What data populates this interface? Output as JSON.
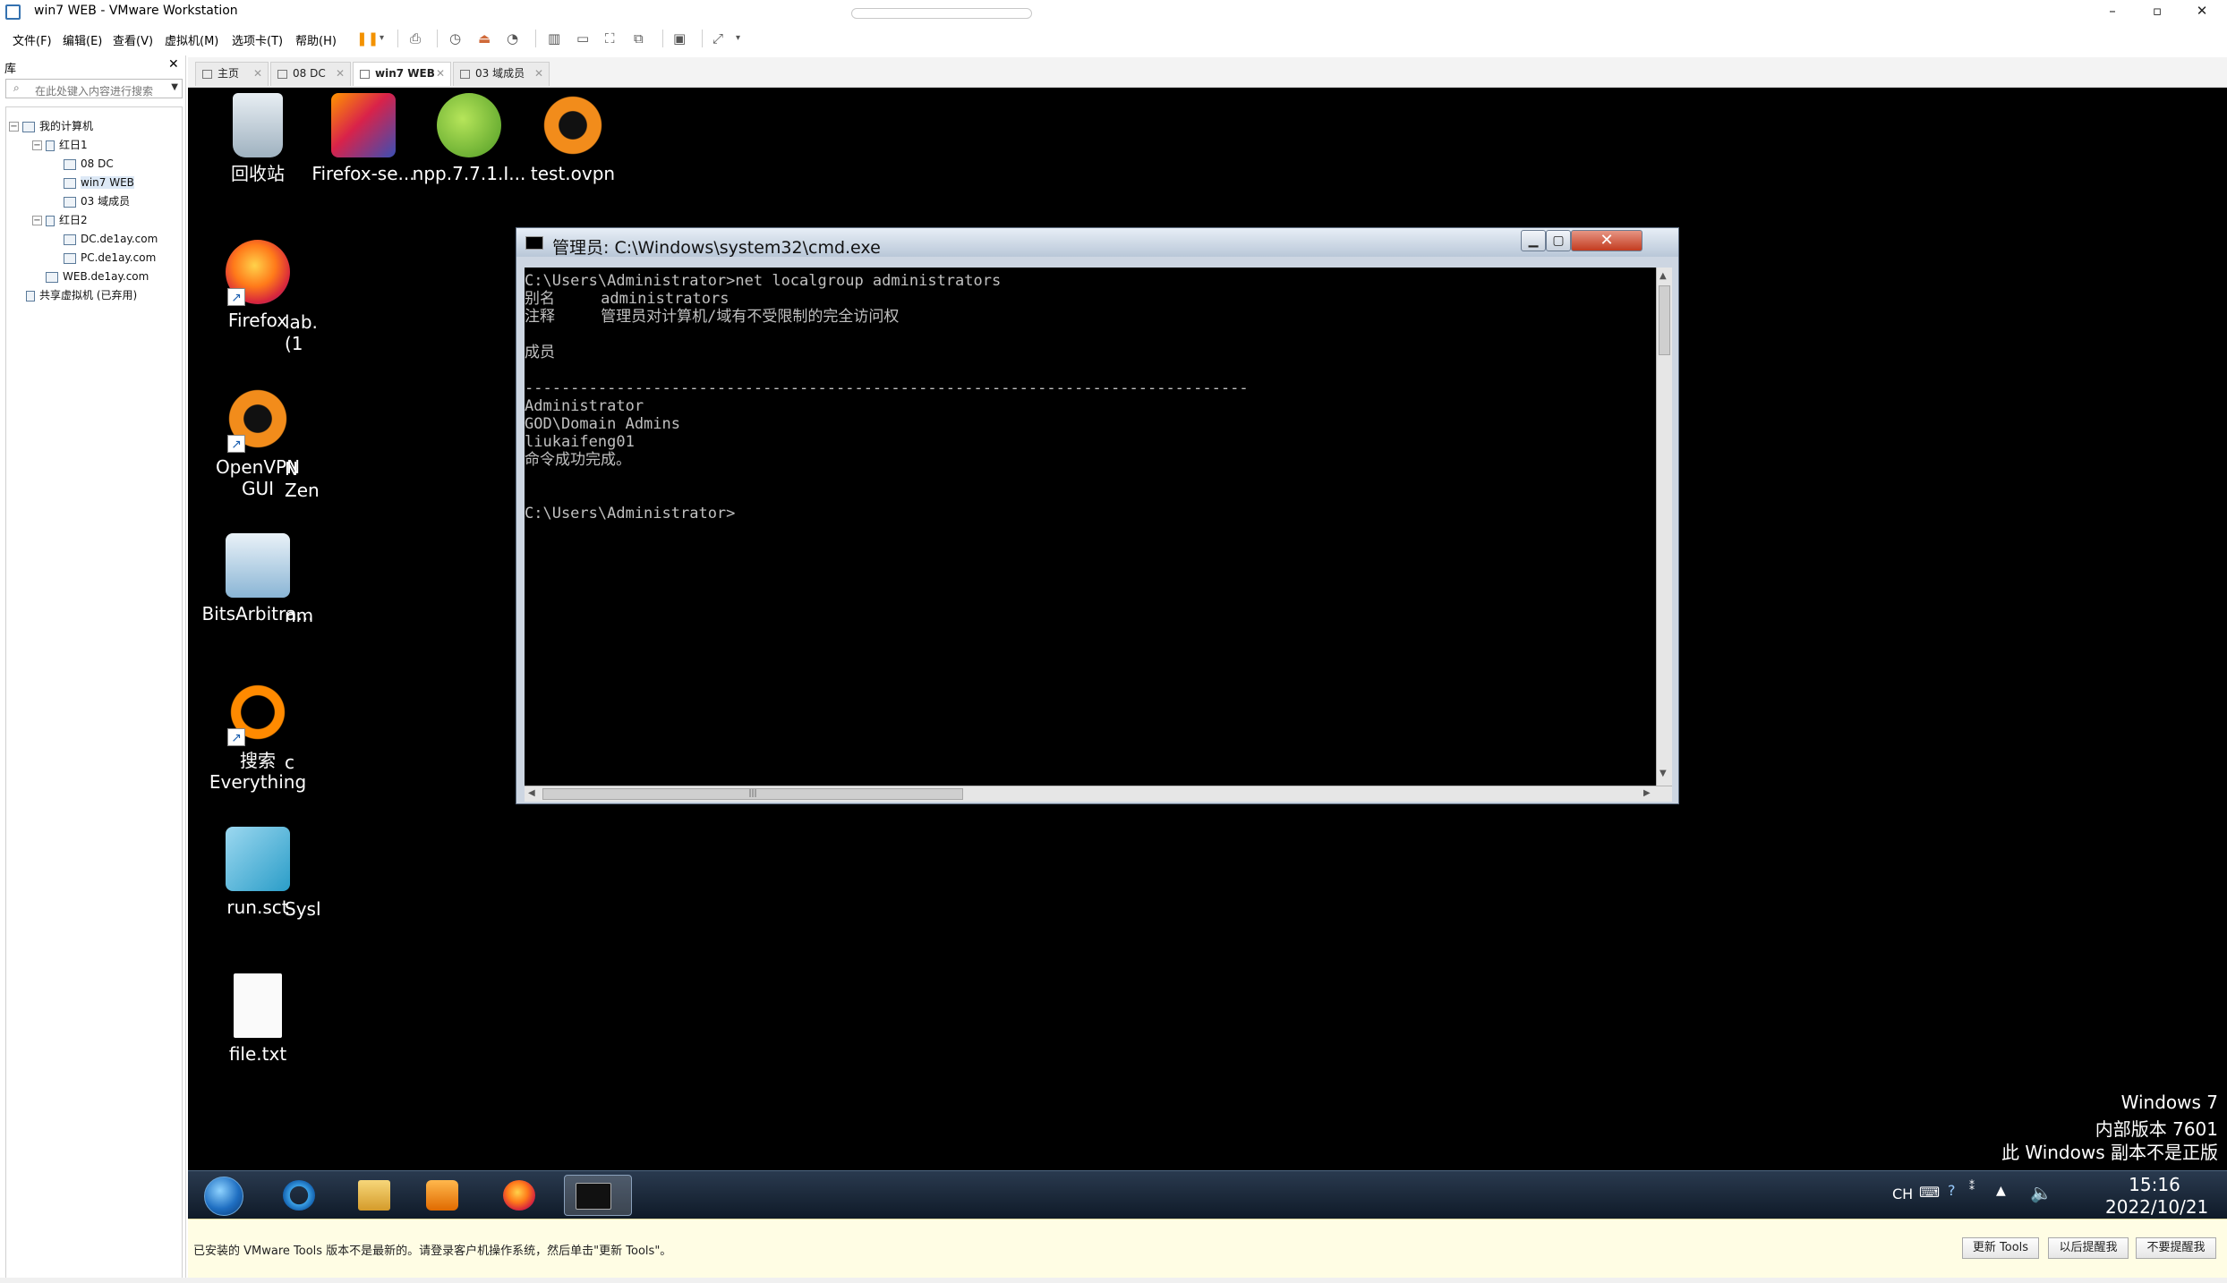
{
  "window": {
    "title": "win7 WEB - VMware Workstation",
    "controls": {
      "minimize": "–",
      "maximize": "▫",
      "close": "✕"
    }
  },
  "menubar": {
    "items": [
      "文件(F)",
      "编辑(E)",
      "查看(V)",
      "虚拟机(M)",
      "选项卡(T)",
      "帮助(H)"
    ]
  },
  "library": {
    "title": "库",
    "close": "✕",
    "search_placeholder": "在此处键入内容进行搜索",
    "tree": [
      {
        "label": "我的计算机"
      },
      {
        "label": "红日1"
      },
      {
        "label": "08 DC"
      },
      {
        "label": "win7 WEB"
      },
      {
        "label": "03 域成员"
      },
      {
        "label": "红日2"
      },
      {
        "label": "DC.de1ay.com"
      },
      {
        "label": "PC.de1ay.com"
      },
      {
        "label": "WEB.de1ay.com"
      },
      {
        "label": "共享虚拟机 (已弃用)"
      }
    ]
  },
  "tabs": [
    {
      "label": "主页"
    },
    {
      "label": "08 DC"
    },
    {
      "label": "win7 WEB"
    },
    {
      "label": "03 域成员"
    }
  ],
  "desktop": {
    "icons": [
      {
        "label": "回收站",
        "icon": "recycle-bin-icon"
      },
      {
        "label": "Firefox-se...",
        "icon": "firefox-setup-icon"
      },
      {
        "label": "npp.7.7.1.I...",
        "icon": "notepad-plus-plus-icon"
      },
      {
        "label": "test.ovpn",
        "icon": "openvpn-config-icon"
      },
      {
        "label": "Firefox",
        "icon": "firefox-icon"
      },
      {
        "label": "OpenVPN GUI",
        "icon": "openvpn-icon"
      },
      {
        "label": "BitsArbitra...",
        "icon": "bits-arbitrator-icon"
      },
      {
        "label": "搜索 Everything",
        "icon": "everything-search-icon"
      },
      {
        "label": "run.sct",
        "icon": "script-file-icon"
      },
      {
        "label": "file.txt",
        "icon": "text-file-icon"
      }
    ],
    "partial_labels": [
      "lab.",
      "(1",
      "N",
      "Zen",
      "nm",
      "c",
      "Sysl"
    ]
  },
  "cmd": {
    "title": "管理员: C:\\Windows\\system32\\cmd.exe",
    "lines": [
      "C:\\Users\\Administrator>net localgroup administrators",
      "别名     administrators",
      "注释     管理员对计算机/域有不受限制的完全访问权",
      "",
      "成员",
      "",
      "-------------------------------------------------------------------------------",
      "Administrator",
      "GOD\\Domain Admins",
      "liukaifeng01",
      "命令成功完成。",
      "",
      "",
      "C:\\Users\\Administrator>"
    ],
    "hscroll_grip": "|||"
  },
  "watermark": {
    "line1": "Windows 7",
    "line2": "内部版本 7601",
    "line3": "此 Windows 副本不是正版"
  },
  "taskbar": {
    "lang": "CH",
    "time": "15:16",
    "date": "2022/10/21"
  },
  "notice": {
    "text": "已安装的 VMware Tools 版本不是最新的。请登录客户机操作系统，然后单击\"更新 Tools\"。",
    "buttons": [
      "更新 Tools",
      "以后提醒我",
      "不要提醒我"
    ]
  },
  "colors": {
    "vm_background": "#000000",
    "console_text": "#c0c0c0",
    "notice_bg": "#fffde4"
  }
}
